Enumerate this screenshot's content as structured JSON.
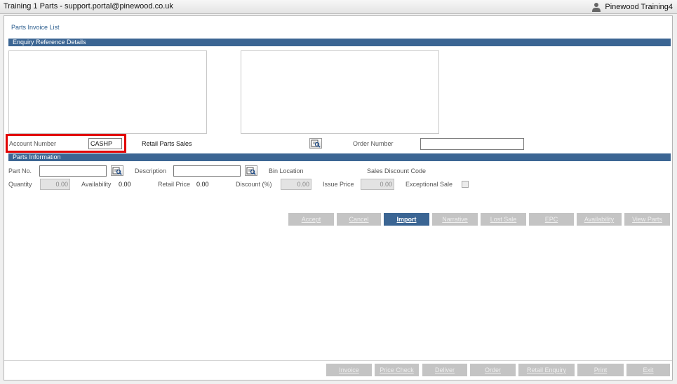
{
  "window": {
    "title": "Training 1 Parts - support.portal@pinewood.co.uk",
    "user_icon": "user-icon",
    "user_name": "Pinewood Training4"
  },
  "page": {
    "title": "Parts Invoice List"
  },
  "enquiry": {
    "section_title": "Enquiry Reference Details",
    "account_number_label": "Account Number",
    "account_number_value": "CASHP",
    "account_name": "Retail Parts Sales",
    "order_number_label": "Order Number",
    "order_number_value": ""
  },
  "parts": {
    "section_title": "Parts Information",
    "part_no_label": "Part No.",
    "part_no_value": "",
    "description_label": "Description",
    "description_value": "",
    "bin_location_label": "Bin Location",
    "sales_discount_code_label": "Sales Discount Code",
    "quantity_label": "Quantity",
    "quantity_value": "0.00",
    "availability_label": "Availability",
    "availability_value": "0.00",
    "retail_price_label": "Retail Price",
    "retail_price_value": "0.00",
    "discount_label": "Discount (%)",
    "discount_value": "0.00",
    "issue_price_label": "Issue Price",
    "issue_price_value": "0.00",
    "exceptional_sale_label": "Exceptional Sale"
  },
  "action_buttons": [
    {
      "label": "Accept",
      "enabled": false
    },
    {
      "label": "Cancel",
      "enabled": false
    },
    {
      "label": "Import",
      "enabled": true
    },
    {
      "label": "Narrative",
      "enabled": false
    },
    {
      "label": "Lost Sale",
      "enabled": false
    },
    {
      "label": "EPC",
      "enabled": false
    },
    {
      "label": "Availability",
      "enabled": false
    },
    {
      "label": "View Parts",
      "enabled": false
    }
  ],
  "footer_buttons": [
    {
      "label": "Invoice",
      "enabled": false
    },
    {
      "label": "Price Check",
      "enabled": false
    },
    {
      "label": "Deliver",
      "enabled": false
    },
    {
      "label": "Order",
      "enabled": false
    },
    {
      "label": "Retail Enquiry",
      "enabled": false
    },
    {
      "label": "Print",
      "enabled": false
    },
    {
      "label": "Exit",
      "enabled": false
    }
  ],
  "colors": {
    "section_bar": "#3b6593",
    "highlight": "#e10000",
    "disabled_button": "#c4c4c4"
  }
}
